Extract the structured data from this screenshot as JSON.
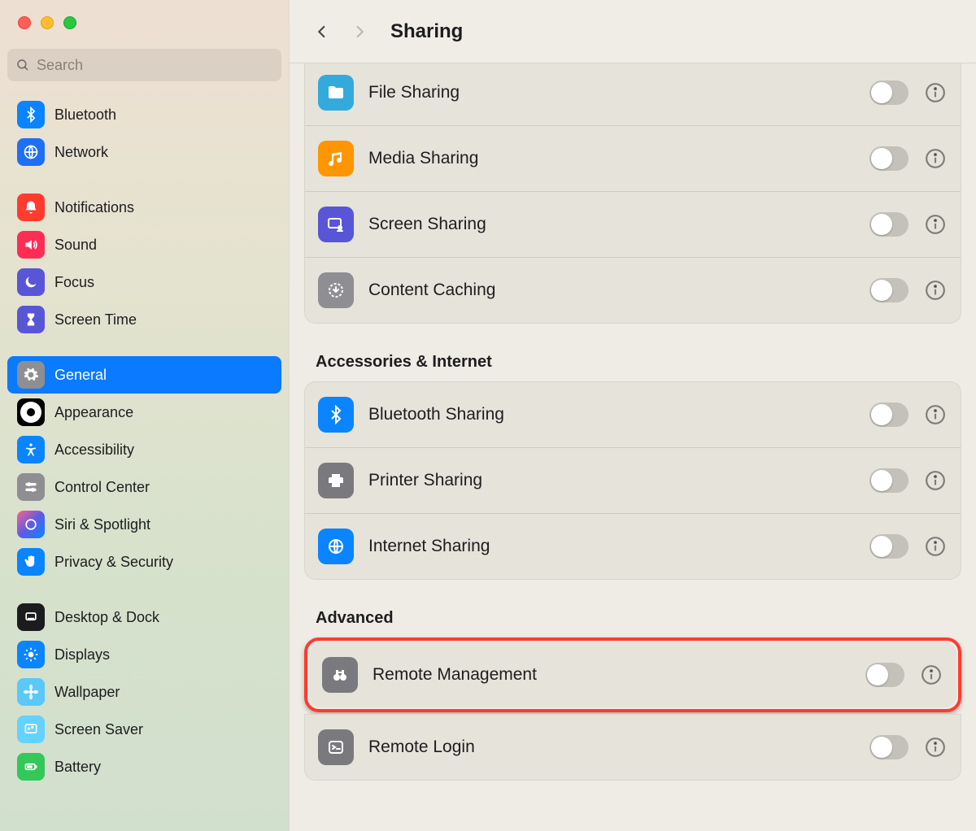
{
  "header": {
    "title": "Sharing"
  },
  "search": {
    "placeholder": "Search"
  },
  "sidebar": {
    "groups": [
      {
        "items": [
          {
            "label": "Bluetooth"
          },
          {
            "label": "Network"
          }
        ]
      },
      {
        "items": [
          {
            "label": "Notifications"
          },
          {
            "label": "Sound"
          },
          {
            "label": "Focus"
          },
          {
            "label": "Screen Time"
          }
        ]
      },
      {
        "items": [
          {
            "label": "General",
            "selected": true
          },
          {
            "label": "Appearance"
          },
          {
            "label": "Accessibility"
          },
          {
            "label": "Control Center"
          },
          {
            "label": "Siri & Spotlight"
          },
          {
            "label": "Privacy & Security"
          }
        ]
      },
      {
        "items": [
          {
            "label": "Desktop & Dock"
          },
          {
            "label": "Displays"
          },
          {
            "label": "Wallpaper"
          },
          {
            "label": "Screen Saver"
          },
          {
            "label": "Battery"
          }
        ]
      }
    ]
  },
  "sections": [
    {
      "title": null,
      "items": [
        {
          "label": "File Sharing",
          "on": false
        },
        {
          "label": "Media Sharing",
          "on": false
        },
        {
          "label": "Screen Sharing",
          "on": false
        },
        {
          "label": "Content Caching",
          "on": false
        }
      ]
    },
    {
      "title": "Accessories & Internet",
      "items": [
        {
          "label": "Bluetooth Sharing",
          "on": false
        },
        {
          "label": "Printer Sharing",
          "on": false
        },
        {
          "label": "Internet Sharing",
          "on": false
        }
      ]
    },
    {
      "title": "Advanced",
      "items": [
        {
          "label": "Remote Management",
          "on": false,
          "highlighted": true
        },
        {
          "label": "Remote Login",
          "on": false
        }
      ]
    }
  ]
}
